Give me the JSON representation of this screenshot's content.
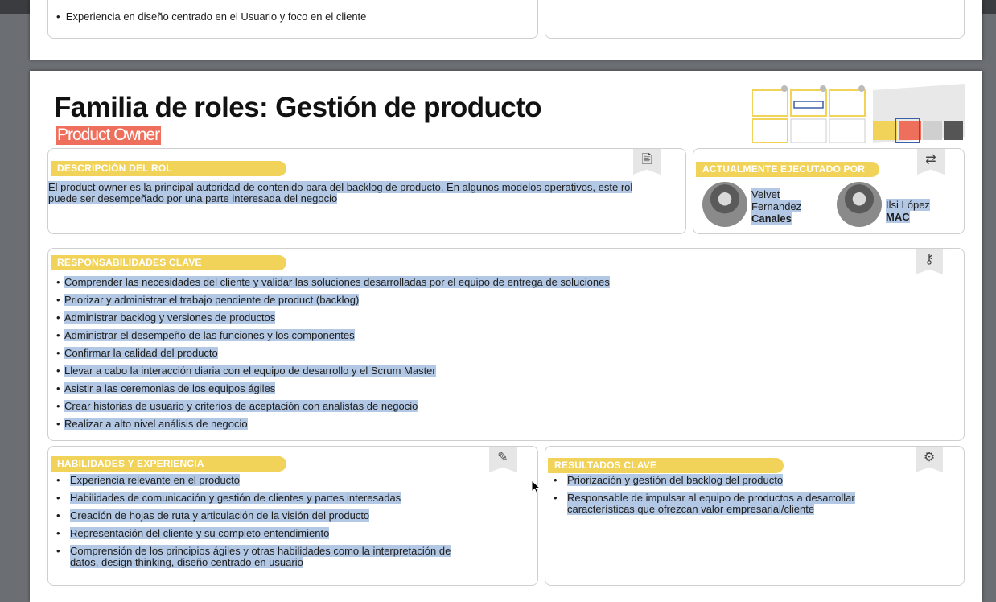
{
  "prev_page": {
    "bullet": "Experiencia en diseño centrado en el Usuario y foco en el cliente"
  },
  "header": {
    "title": "Familia de roles: Gestión de producto",
    "subtitle": "Product Owner"
  },
  "descripcion": {
    "heading": "DESCRIPCIÓN DEL ROL",
    "text": "El product owner es la principal autoridad de contenido para del backlog de producto. En algunos modelos operativos, este rol puede ser desempeñado por una parte interesada del negocio",
    "icon": "document-edit-icon"
  },
  "ejecutado": {
    "heading": "ACTUALMENTE EJECUTADO POR",
    "icon": "person-arrows-icon",
    "people": [
      {
        "line1": "Velvet",
        "line2": "Fernandez",
        "line3": "Canales"
      },
      {
        "line1": "Ilsi López",
        "line2": "MAC"
      }
    ]
  },
  "responsabilidades": {
    "heading": "RESPONSABILIDADES CLAVE",
    "icon": "key-icon",
    "items": [
      "Comprender las necesidades del cliente y validar las soluciones desarrolladas por el equipo de entrega de soluciones",
      "Priorizar y administrar el trabajo pendiente de product (backlog)",
      "Administrar backlog y versiones de productos",
      "Administrar el desempeño de las funciones y los componentes",
      "Confirmar la calidad del producto",
      "Llevar a cabo la interacción diaria con el equipo de desarrollo y el Scrum Master",
      "Asistir a las ceremonias de los equipos ágiles",
      "Crear historias de usuario y criterios de aceptación con analistas de negocio",
      "Realizar a alto nivel análisis de negocio"
    ]
  },
  "habilidades": {
    "heading": "HABILIDADES Y EXPERIENCIA",
    "icon": "tools-cup-icon",
    "items": [
      "Experiencia relevante en el producto",
      "Habilidades de comunicación y gestión de clientes y partes interesadas",
      "Creación de hojas de ruta y articulación de la visión del producto",
      "Representación del cliente y su completo entendimiento",
      "Comprensión de los principios ágiles y otras habilidades como la interpretación de",
      "datos, design thinking, diseño centrado en usuario"
    ]
  },
  "resultados": {
    "heading": "RESULTADOS CLAVE",
    "icon": "network-icon",
    "items": [
      "Priorización y gestión del backlog del producto",
      "Responsable de impulsar al equipo de productos a desarrollar",
      "características que ofrezcan valor empresarial/cliente"
    ]
  },
  "colors": {
    "accent_yellow": "#f2d35a",
    "subtitle_red": "#ef6f5d",
    "selection_blue": "#b3c8e4"
  }
}
